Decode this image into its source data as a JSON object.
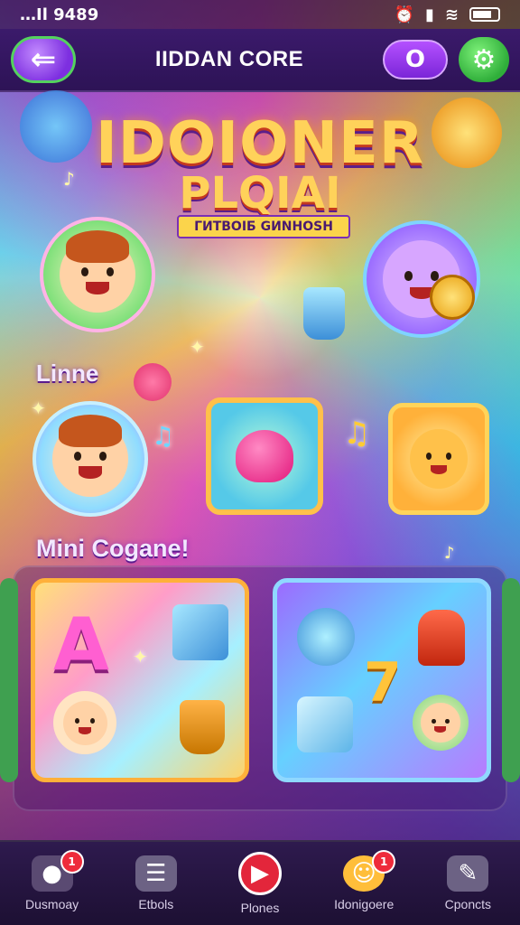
{
  "status_bar": {
    "left": "…Il 9489",
    "icons": [
      "alarm-icon",
      "signal-icon",
      "wifi-icon",
      "battery-icon"
    ]
  },
  "header": {
    "back_icon": "arrow-left-icon",
    "title": "IIDDAN CORE",
    "coin_value": "O",
    "settings_icon": "gear-icon"
  },
  "hero": {
    "title_line1": "IDOIONER",
    "title_line2": "PLQIAI",
    "subtitle": "ГИТВОІБ GИNHOSH"
  },
  "sections": {
    "featured_label": "Linne",
    "mini_games_label": "Mini Cogane!"
  },
  "mini_games": {
    "card_a_glyph": "A",
    "card_b_glyph": "7"
  },
  "bottom_nav": [
    {
      "label": "Dusmoay",
      "icon": "controller-icon",
      "badge": "1"
    },
    {
      "label": "Etbols",
      "icon": "document-icon",
      "badge": ""
    },
    {
      "label": "Plones",
      "icon": "play-icon",
      "badge": ""
    },
    {
      "label": "Idonigoere",
      "icon": "character-icon",
      "badge": "1"
    },
    {
      "label": "Cponcts",
      "icon": "pencil-icon",
      "badge": ""
    }
  ],
  "colors": {
    "accent_purple": "#7d2fe0",
    "accent_green": "#2fae3a",
    "title_gold": "#ffd25a",
    "badge_red": "#ee2b3b"
  }
}
